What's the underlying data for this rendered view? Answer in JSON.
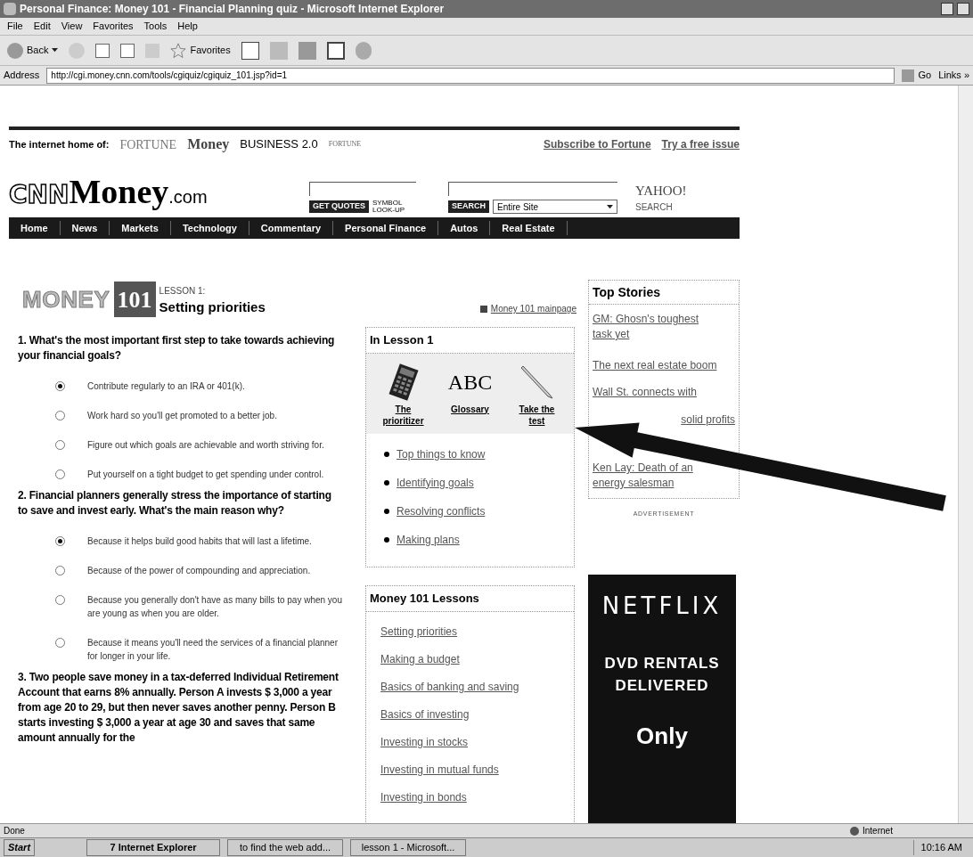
{
  "window": {
    "title": "Personal Finance: Money 101 - Financial Planning quiz - Microsoft Internet Explorer"
  },
  "menu": [
    "File",
    "Edit",
    "View",
    "Favorites",
    "Tools",
    "Help"
  ],
  "toolbar": {
    "back": "Back",
    "favorites": "Favorites"
  },
  "address": {
    "label": "Address",
    "url": "http://cgi.money.cnn.com/tools/cgiquiz/cgiquiz_101.jsp?id=1",
    "go": "Go",
    "links": "Links »"
  },
  "header": {
    "tagline": "The internet home of:",
    "brands": [
      "FORTUNE",
      "Money",
      "BUSINESS 2.0",
      "FORTUNE"
    ],
    "links": [
      "Subscribe to Fortune",
      "Try a free issue"
    ],
    "logo": {
      "brand": "CNN",
      "name": "Money",
      "suffix": ".com"
    },
    "quotes_button": "GET QUOTES",
    "symbol_lookup": "SYMBOL LOOK-UP",
    "search_button": "SEARCH",
    "scope": "Entire Site",
    "yahoo": "YAHOO!",
    "yahoo_sub": "SEARCH"
  },
  "nav": [
    "Home",
    "News",
    "Markets",
    "Technology",
    "Commentary",
    "Personal Finance",
    "Autos",
    "Real Estate"
  ],
  "lesson": {
    "badge_word": "MONEY",
    "badge_number": "101",
    "kicker": "LESSON 1:",
    "title": "Setting priorities",
    "mainpage_link": "Money 101 mainpage"
  },
  "questions": [
    {
      "text": "1. What's the most important first step to take towards achieving your financial goals?",
      "options": [
        {
          "label": "Contribute regularly to an IRA or 401(k).",
          "selected": true
        },
        {
          "label": "Work hard so you'll get promoted to a better job.",
          "selected": false
        },
        {
          "label": "Figure out which goals are achievable and worth striving for.",
          "selected": false
        },
        {
          "label": "Put yourself on a tight budget to get spending under control.",
          "selected": false
        }
      ]
    },
    {
      "text": "2. Financial planners generally stress the importance of starting to save and invest early. What's the main reason why?",
      "options": [
        {
          "label": "Because it helps build good habits that will last a lifetime.",
          "selected": true
        },
        {
          "label": "Because of the power of compounding and appreciation.",
          "selected": false
        },
        {
          "label": "Because you generally don't have as many bills to pay when you are young as when you are older.",
          "selected": false
        },
        {
          "label": "Because it means you'll need the services of a financial planner for longer in your life.",
          "selected": false
        }
      ]
    },
    {
      "text": "3. Two people save money in a tax-deferred Individual Retirement Account that earns 8% annually. Person A invests $ 3,000 a year from age 20 to 29, but then never saves another penny. Person B starts investing $ 3,000 a year at age 30 and saves that same amount annually for the"
    }
  ],
  "in_lesson": {
    "title": "In Lesson 1",
    "tools": [
      {
        "kind": "calculator",
        "label": "The prioritizer"
      },
      {
        "kind": "letters",
        "label": "Glossary",
        "art": "ABC"
      },
      {
        "kind": "pencil",
        "label": "Take the test"
      }
    ],
    "links": [
      "Top things to know",
      "Identifying goals",
      "Resolving conflicts",
      "Making plans"
    ]
  },
  "lessons": {
    "title": "Money 101 Lessons",
    "links": [
      "Setting priorities",
      "Making a budget",
      "Basics of banking and saving",
      "Basics of investing",
      "Investing in stocks",
      "Investing in mutual funds",
      "Investing in bonds"
    ]
  },
  "top_stories": {
    "title": "Top Stories",
    "stories": [
      "GM: Ghosn's toughest task yet",
      "The next real estate boom",
      "Wall St. connects with",
      "solid profits",
      "Ken Lay: Death of an energy salesman"
    ]
  },
  "ad": {
    "label": "ADVERTISEMENT",
    "brand": "NETFLIX",
    "lines": [
      "DVD RENTALS",
      "DELIVERED"
    ],
    "offer": "Only"
  },
  "status": {
    "text": "Done",
    "zone": "Internet"
  },
  "taskbar": {
    "start": "Start",
    "tasks": [
      "7 Internet Explorer",
      "to find the web add...",
      "lesson 1 - Microsoft..."
    ],
    "clock": "10:16 AM"
  }
}
